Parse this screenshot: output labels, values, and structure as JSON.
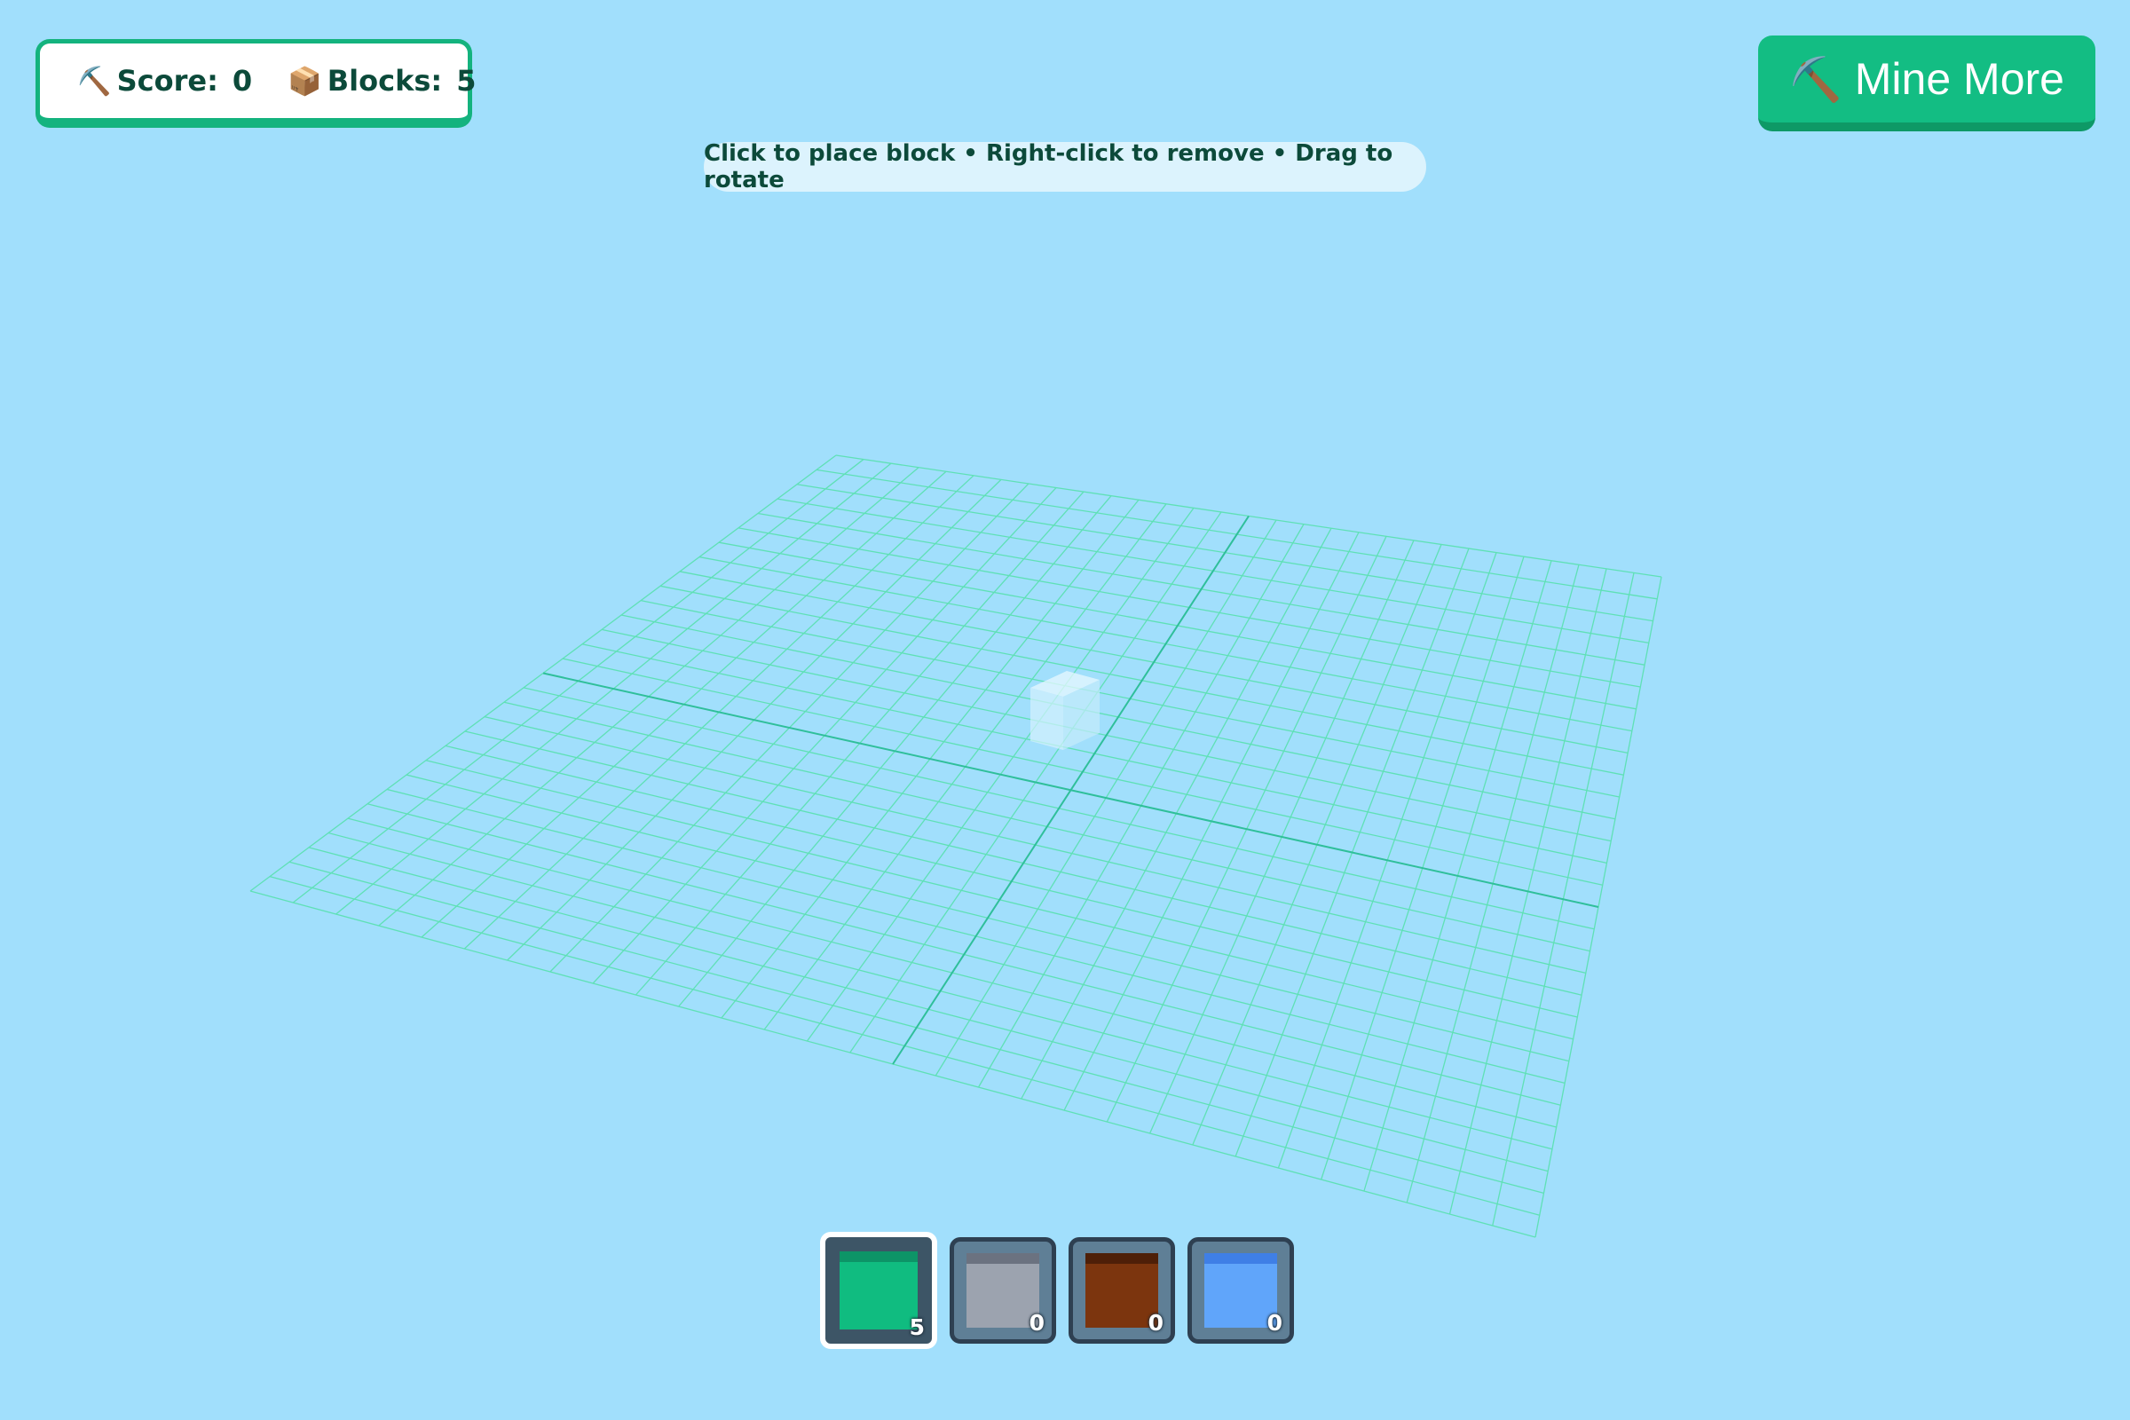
{
  "hud": {
    "score_label": "Score:",
    "score_value": "0",
    "blocks_label": "Blocks:",
    "blocks_value": "5",
    "score_emoji": "⛏️",
    "blocks_emoji": "📦"
  },
  "mine_button": {
    "emoji": "⛏️",
    "label": "Mine More"
  },
  "hint": "Click to place block • Right-click to remove • Drag to rotate",
  "hotbar": [
    {
      "name": "grass",
      "top_color": "#0d9467",
      "color": "#10bc80",
      "count": "5",
      "selected": true
    },
    {
      "name": "stone",
      "top_color": "#6b7280",
      "color": "#9ca3af",
      "count": "0",
      "selected": false
    },
    {
      "name": "dirt",
      "top_color": "#4e1f08",
      "color": "#7c350e",
      "count": "0",
      "selected": false
    },
    {
      "name": "water",
      "top_color": "#3f7fe6",
      "color": "#60a5fa",
      "count": "0",
      "selected": false
    }
  ],
  "colors": {
    "background": "#a1dffc",
    "accent": "#14b37e",
    "grid_line": "#5fe0b6",
    "axis_line": "#2fbf9a",
    "ghost_block": "#e6f7ff"
  }
}
